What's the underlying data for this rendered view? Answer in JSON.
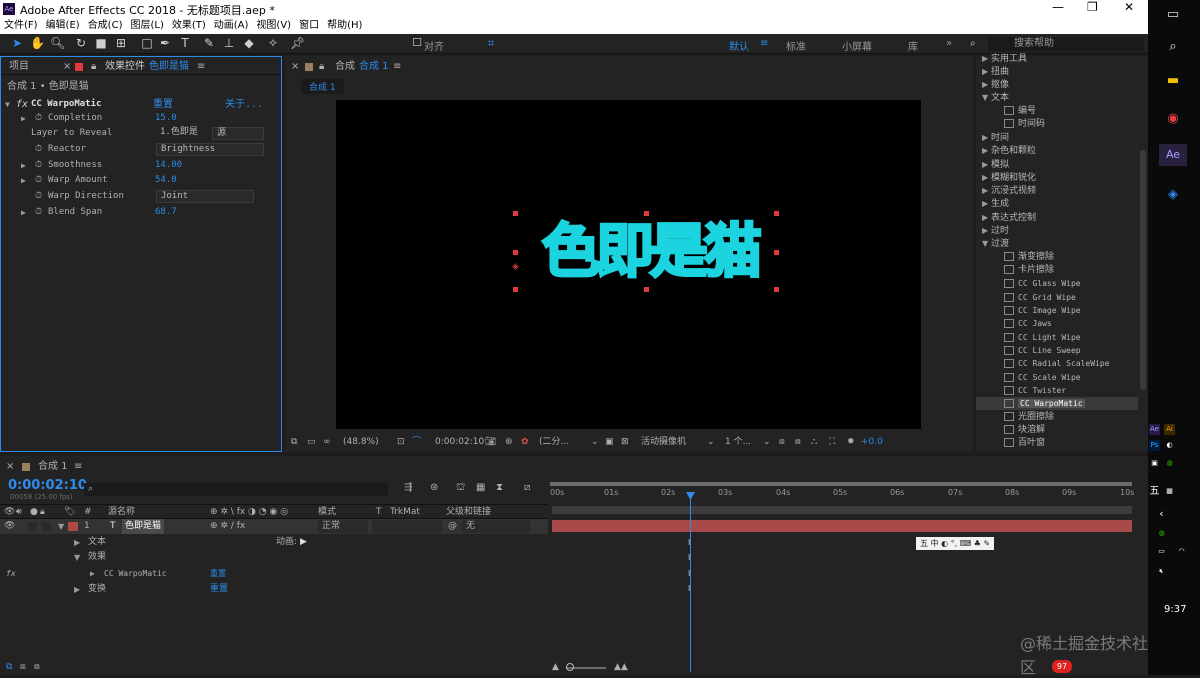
{
  "window": {
    "title": "Adobe After Effects CC 2018 - 无标题项目.aep *"
  },
  "menu": [
    "文件(F)",
    "编辑(E)",
    "合成(C)",
    "图层(L)",
    "效果(T)",
    "动画(A)",
    "视图(V)",
    "窗口",
    "帮助(H)"
  ],
  "toolbar": {
    "align_label": "对齐",
    "workspaces": [
      "默认",
      "标准",
      "小屏幕",
      "库"
    ],
    "search_placeholder": "搜索帮助"
  },
  "left_panel": {
    "tab_project": "项目",
    "tab_effects": "效果控件",
    "tab_effects_layer": "色即是猫",
    "breadcrumb": "合成 1 • 色即是猫",
    "effect_name": "CC WarpoMatic",
    "reset": "重置",
    "about": "关于...",
    "props": [
      {
        "name": "Completion",
        "value": "15.0"
      },
      {
        "name": "Layer to Reveal",
        "value": "1.色即是",
        "value2": "源"
      },
      {
        "name": "Reactor",
        "value": "Brightness"
      },
      {
        "name": "Smoothness",
        "value": "14.00"
      },
      {
        "name": "Warp Amount",
        "value": "54.0"
      },
      {
        "name": "Warp Direction",
        "value": "Joint"
      },
      {
        "name": "Blend Span",
        "value": "68.7"
      }
    ]
  },
  "comp_panel": {
    "tab_label": "合成",
    "comp_name": "合成 1",
    "sub_tab": "合成 1",
    "canvas_text": "色即是猫",
    "zoom": "(48.8%)",
    "timecode": "0:00:02:10",
    "resolution": "(二分...",
    "camera": "活动摄像机",
    "views": "1 个...",
    "exposure": "+0.0"
  },
  "effects_panel": {
    "items": [
      {
        "label": "实用工具",
        "kind": "cat",
        "open": false
      },
      {
        "label": "扭曲",
        "kind": "cat",
        "open": false
      },
      {
        "label": "抠像",
        "kind": "cat",
        "open": false
      },
      {
        "label": "文本",
        "kind": "cat",
        "open": true
      },
      {
        "label": "编号",
        "kind": "item"
      },
      {
        "label": "时间码",
        "kind": "item"
      },
      {
        "label": "时间",
        "kind": "cat",
        "open": false
      },
      {
        "label": "杂色和颗粒",
        "kind": "cat",
        "open": false
      },
      {
        "label": "模拟",
        "kind": "cat",
        "open": false
      },
      {
        "label": "模糊和锐化",
        "kind": "cat",
        "open": false
      },
      {
        "label": "沉浸式视频",
        "kind": "cat",
        "open": false
      },
      {
        "label": "生成",
        "kind": "cat",
        "open": false
      },
      {
        "label": "表达式控制",
        "kind": "cat",
        "open": false
      },
      {
        "label": "过时",
        "kind": "cat",
        "open": false
      },
      {
        "label": "过渡",
        "kind": "cat",
        "open": true
      },
      {
        "label": "渐变擦除",
        "kind": "item"
      },
      {
        "label": "卡片擦除",
        "kind": "item"
      },
      {
        "label": "CC Glass Wipe",
        "kind": "item"
      },
      {
        "label": "CC Grid Wipe",
        "kind": "item"
      },
      {
        "label": "CC Image Wipe",
        "kind": "item"
      },
      {
        "label": "CC Jaws",
        "kind": "item"
      },
      {
        "label": "CC Light Wipe",
        "kind": "item"
      },
      {
        "label": "CC Line Sweep",
        "kind": "item"
      },
      {
        "label": "CC Radial ScaleWipe",
        "kind": "item"
      },
      {
        "label": "CC Scale Wipe",
        "kind": "item"
      },
      {
        "label": "CC Twister",
        "kind": "item"
      },
      {
        "label": "CC WarpoMatic",
        "kind": "item",
        "selected": true
      },
      {
        "label": "光圈擦除",
        "kind": "item"
      },
      {
        "label": "块溶解",
        "kind": "item"
      },
      {
        "label": "百叶窗",
        "kind": "item"
      }
    ]
  },
  "timeline": {
    "tab": "合成 1",
    "timecode": "0:00:02:10",
    "frame_info": "00058 (25.00 fps)",
    "columns": {
      "source": "源名称",
      "mode": "模式",
      "t": "T",
      "trkmat": "TrkMat",
      "parent": "父级和链接"
    },
    "layer": {
      "num": "1",
      "type": "T",
      "name": "色即是猫",
      "mode": "正常",
      "parent": "无"
    },
    "sub_rows": [
      {
        "label": "文本",
        "extra": "动画:"
      },
      {
        "label": "效果"
      },
      {
        "label": "CC WarpoMatic",
        "reset": "重置"
      },
      {
        "label": "变换",
        "reset": "重置"
      }
    ],
    "ruler": [
      "00s",
      "01s",
      "02s",
      "03s",
      "04s",
      "05s",
      "06s",
      "07s",
      "08s",
      "09s",
      "10s"
    ],
    "ime": "五 中 ◐ °, ⌨ ♣ ✎",
    "watermark": "@稀土掘金技术社区",
    "badge": "97"
  },
  "taskbar": {
    "clock": "9:37",
    "ime": "五"
  }
}
